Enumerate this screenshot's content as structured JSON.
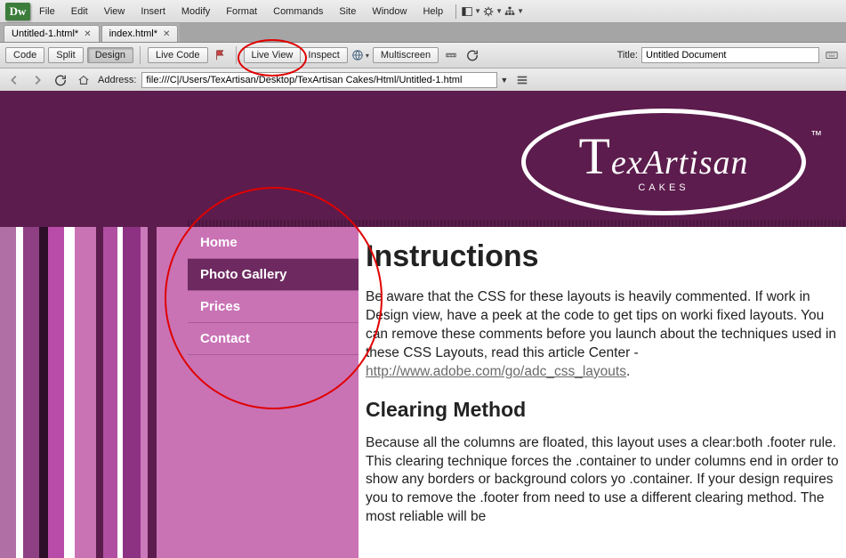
{
  "menu": [
    "File",
    "Edit",
    "View",
    "Insert",
    "Modify",
    "Format",
    "Commands",
    "Site",
    "Window",
    "Help"
  ],
  "tabs": [
    {
      "label": "Untitled-1.html*"
    },
    {
      "label": "index.html*"
    }
  ],
  "toolbar": {
    "code": "Code",
    "split": "Split",
    "design": "Design",
    "livecode": "Live Code",
    "liveview": "Live View",
    "inspect": "Inspect",
    "multiscreen": "Multiscreen",
    "title_label": "Title:",
    "title_value": "Untitled Document"
  },
  "address": {
    "label": "Address:",
    "value": "file:///C|/Users/TexArtisan/Desktop/TexArtisan Cakes/Html/Untitled-1.html"
  },
  "logo": {
    "brand": "TexArtisan",
    "sub": "CAKES",
    "tm": "™"
  },
  "nav": [
    {
      "label": "Home",
      "active": false
    },
    {
      "label": "Photo Gallery",
      "active": true
    },
    {
      "label": "Prices",
      "active": false
    },
    {
      "label": "Contact",
      "active": false
    }
  ],
  "content": {
    "h1": "Instructions",
    "p1": "Be aware that the CSS for these layouts is heavily commented. If work in Design view, have a peek at the code to get tips on worki fixed layouts. You can remove these comments before you launch about the techniques used in these CSS Layouts, read this article Center - ",
    "link": "http://www.adobe.com/go/adc_css_layouts",
    "period": ".",
    "h2": "Clearing Method",
    "p2": "Because all the columns are floated, this layout uses a clear:both .footer rule. This clearing technique forces the .container to under columns end in order to show any borders or background colors yo .container. If your design requires you to remove the .footer from need to use a different clearing method. The most reliable will be"
  }
}
